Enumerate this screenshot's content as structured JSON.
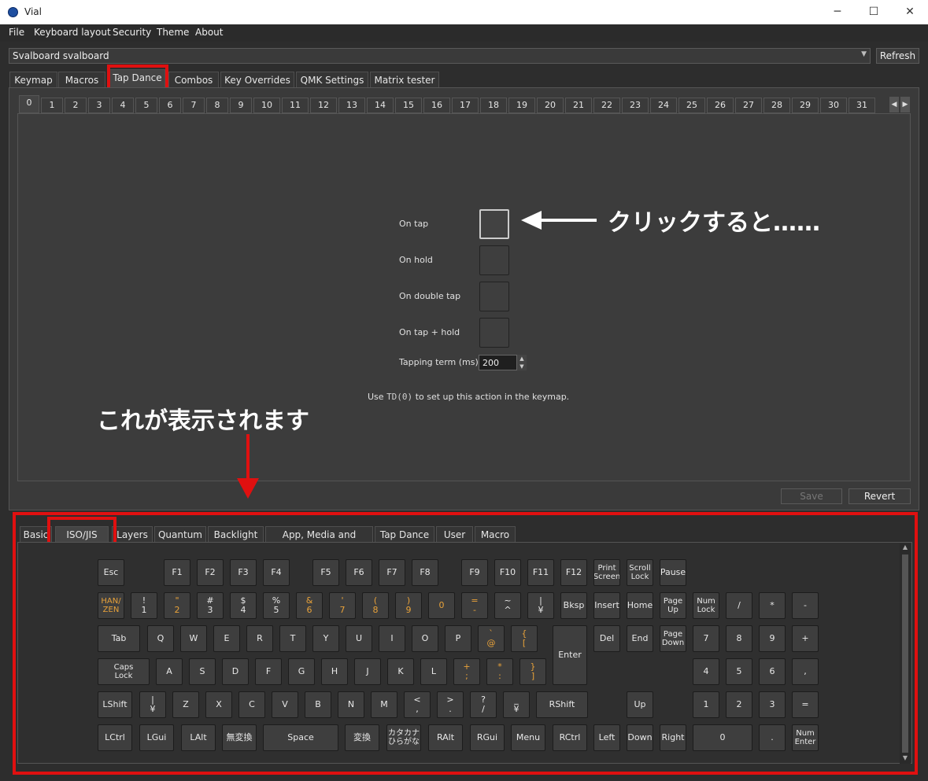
{
  "window": {
    "title": "Vial",
    "minimize": "─",
    "maximize": "☐",
    "close": "✕"
  },
  "menu": [
    "File",
    "Keyboard layout",
    "Security",
    "Theme",
    "About"
  ],
  "keyboard_select": {
    "value": "Svalboard svalboard",
    "refresh": "Refresh"
  },
  "main_tabs": [
    "Keymap",
    "Macros",
    "Tap Dance",
    "Combos",
    "Key Overrides",
    "QMK Settings",
    "Matrix tester"
  ],
  "active_main_tab": "Tap Dance",
  "td_number_tabs": [
    "0",
    "1",
    "2",
    "3",
    "4",
    "5",
    "6",
    "7",
    "8",
    "9",
    "10",
    "11",
    "12",
    "13",
    "14",
    "15",
    "16",
    "17",
    "18",
    "19",
    "20",
    "21",
    "22",
    "23",
    "24",
    "25",
    "26",
    "27",
    "28",
    "29",
    "30",
    "31"
  ],
  "tap_dance": {
    "on_tap": "On tap",
    "on_hold": "On hold",
    "on_double_tap": "On double tap",
    "on_tap_hold": "On tap + hold",
    "tapping_term_label": "Tapping term (ms)",
    "tapping_term_value": "200",
    "use_prefix": "Use",
    "use_code": "TD(0)",
    "use_suffix": "to set up this action in the keymap.",
    "save": "Save",
    "revert": "Revert"
  },
  "annotations": {
    "click": "クリックすると……",
    "shown": "これが表示されます"
  },
  "keycode_tabs": [
    "Basic",
    "ISO/JIS",
    "Layers",
    "Quantum",
    "Backlight",
    "App, Media and Mouse",
    "Tap Dance",
    "User",
    "Macro"
  ],
  "active_keycode_tab": "ISO/JIS",
  "keys": {
    "esc": "Esc",
    "f1": "F1",
    "f2": "F2",
    "f3": "F3",
    "f4": "F4",
    "f5": "F5",
    "f6": "F6",
    "f7": "F7",
    "f8": "F8",
    "f9": "F9",
    "f10": "F10",
    "f11": "F11",
    "f12": "F12",
    "print": "Print\nScreen",
    "scroll": "Scroll\nLock",
    "pause": "Pause",
    "hanzen": "HAN/\nZEN",
    "k1": "!\n1",
    "k2": "\"\n2",
    "k3": "#\n3",
    "k4": "$\n4",
    "k5": "%\n5",
    "k6": "&\n6",
    "k7": "'\n7",
    "k8": "(\n8",
    "k9": ")\n9",
    "k0": "0",
    "kminus": "=\n-",
    "kcaret": "~\n^",
    "kyen": "|\n¥",
    "bksp": "Bksp",
    "insert": "Insert",
    "home": "Home",
    "pgup": "Page\nUp",
    "numlock": "Num\nLock",
    "pslash": "/",
    "pstar": "*",
    "pminus": "-",
    "tab": "Tab",
    "q": "Q",
    "w": "W",
    "e": "E",
    "r": "R",
    "t": "T",
    "y": "Y",
    "u": "U",
    "i": "I",
    "o": "O",
    "p": "P",
    "at": "`\n@",
    "lbr": "{\n[",
    "enter": "Enter",
    "del": "Del",
    "end": "End",
    "pgdn": "Page\nDown",
    "p7": "7",
    "p8": "8",
    "p9": "9",
    "pplus": "+",
    "caps": "Caps\nLock",
    "a": "A",
    "s": "S",
    "d": "D",
    "f": "F",
    "g": "G",
    "h": "H",
    "j": "J",
    "k": "K",
    "l": "L",
    "semi": "+\n;",
    "colon": "*\n:",
    "rbr": "}\n]",
    "p4": "4",
    "p5": "5",
    "p6": "6",
    "pcomma": ",",
    "lshift": "LShift",
    "bslash": "|\n¥",
    "z": "Z",
    "x": "X",
    "c": "C",
    "v": "V",
    "b": "B",
    "n": "N",
    "m": "M",
    "comma": "<\n,",
    "dot": ">\n.",
    "slash": "?\n/",
    "ro": "_\n¥",
    "rshift": "RShift",
    "up": "Up",
    "p1": "1",
    "p2": "2",
    "p3": "3",
    "pequal": "=",
    "lctrl": "LCtrl",
    "lgui": "LGui",
    "lalt": "LAlt",
    "muhenkan": "無変換",
    "space": "Space",
    "henkan": "変換",
    "kana": "カタカナ\nひらがな",
    "ralt": "RAlt",
    "rgui": "RGui",
    "menu": "Menu",
    "rctrl": "RCtrl",
    "left": "Left",
    "down": "Down",
    "right": "Right",
    "p0": "0",
    "pdot": ".",
    "penter": "Num\nEnter"
  },
  "colors": {
    "accent_red": "#e01010",
    "key_symbol_orange": "#e8a23a",
    "background": "#2d2d2d"
  }
}
